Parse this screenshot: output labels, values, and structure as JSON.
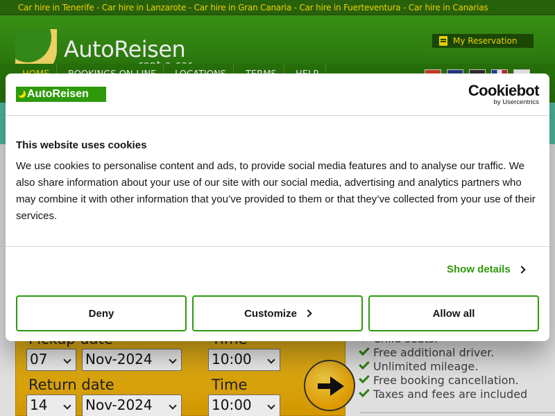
{
  "topbar": {
    "links_text": "Car hire in Tenerife - Car hire in Lanzarote - Car hire in Gran Canaria - Car hire in Fuerteventura - Car hire in Canarias"
  },
  "header": {
    "brand": "AutoReisen",
    "tagline": "rent a car",
    "reservation_label": "My Reservation"
  },
  "nav": {
    "items": [
      "HOME",
      "BOOKINGS ON-LINE",
      "LOCATIONS",
      "TERMS",
      "HELP"
    ]
  },
  "booking": {
    "pickup_label": "Pickup date",
    "pickup_time_label": "Time",
    "pickup_day": "07",
    "pickup_month": "Nov-2024",
    "pickup_time": "10:00",
    "return_label": "Return date",
    "return_time_label": "Time",
    "return_day": "14",
    "return_month": "Nov-2024",
    "return_time": "10:00"
  },
  "features": [
    "Child seats.",
    "Free additional driver.",
    "Unlimited mileage.",
    "Free booking cancellation.",
    "Taxes and fees are included"
  ],
  "cookie_dialog": {
    "logo_text": "AutoReisen",
    "provider": "Cookiebot",
    "provider_by": "by Usercentrics",
    "title": "This website uses cookies",
    "body": "We use cookies to personalise content and ads, to provide social media features and to analyse our traffic. We also share information about your use of our site with our social media, advertising and analytics partners who may combine it with other information that you’ve provided to them or that they’ve collected from your use of their services.",
    "show_details": "Show details",
    "deny": "Deny",
    "customize": "Customize",
    "allow_all": "Allow all",
    "accent_color": "#2e9a0b"
  }
}
